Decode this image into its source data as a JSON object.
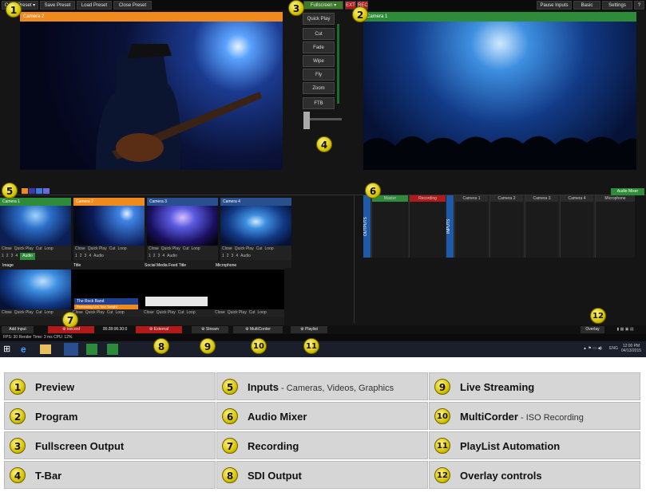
{
  "toolbar": {
    "open_preset": "Open Preset",
    "save_preset": "Save Preset",
    "load_preset": "Load Preset",
    "close_preset": "Close Preset",
    "fullscreen": "Fullscreen",
    "ext": "EXT",
    "rec": "REC",
    "pause_inputs": "Pause Inputs",
    "basic": "Basic",
    "settings": "Settings",
    "help": "?"
  },
  "preview": {
    "label": "Camera 2"
  },
  "program": {
    "label": "Camera 1"
  },
  "transitions": [
    "Quick Play",
    "Cut",
    "Fade",
    "Wipe",
    "Fly",
    "Zoom",
    "FTB"
  ],
  "audio_mixer_button": "Audio Mixer",
  "inputs": [
    {
      "label": "Camera 1",
      "color": "#2e8b3a"
    },
    {
      "label": "Camera 2",
      "color": "#f08a1c"
    },
    {
      "label": "Camera 3",
      "color": "#2a4f8f"
    },
    {
      "label": "Camera 4",
      "color": "#2a4f8f"
    },
    {
      "label": "Image",
      "color": "#1d1d1d"
    },
    {
      "label": "Title",
      "color": "#1d1d1d",
      "title_text": "The Rock Band",
      "title_sub": "Performing Live Tour Tonight"
    },
    {
      "label": "Social Media Feed Title",
      "color": "#1d1d1d"
    },
    {
      "label": "Microphone",
      "color": "#1d1d1d"
    }
  ],
  "input_controls": [
    "Close",
    "Quick Play",
    "Cut",
    "Loop"
  ],
  "input_numbers": [
    "1",
    "2",
    "3",
    "4",
    "Audio"
  ],
  "mixer": {
    "outputs_label": "OUTPUTS",
    "inputs_label": "INPUTS",
    "master": "Master",
    "recording": "Recording",
    "channels": [
      "Camera 1",
      "Camera 2",
      "Camera 3",
      "Camera 4",
      "Microphone"
    ],
    "buttons": [
      "M",
      "A",
      "B"
    ]
  },
  "bottom": {
    "add_input": "Add Input",
    "record": "Record",
    "record_time": "00:28:06:30:0",
    "external": "External",
    "stream": "Stream",
    "multicorder": "MultiCorder",
    "playlist": "Playlist",
    "overlay": "Overlay"
  },
  "status": {
    "text": "FPS: 30  Render Time: 3 ms  CPU: 12%"
  },
  "taskbar": {
    "lang": "ENG",
    "time": "12:00 PM",
    "date": "04/13/2015"
  },
  "legend": [
    {
      "n": "1",
      "title": "Preview",
      "sub": ""
    },
    {
      "n": "5",
      "title": "Inputs",
      "sub": " - Cameras, Videos, Graphics"
    },
    {
      "n": "9",
      "title": "Live Streaming",
      "sub": ""
    },
    {
      "n": "2",
      "title": "Program",
      "sub": ""
    },
    {
      "n": "6",
      "title": "Audio Mixer",
      "sub": ""
    },
    {
      "n": "10",
      "title": "MultiCorder",
      "sub": " - ISO Recording"
    },
    {
      "n": "3",
      "title": "Fullscreen Output",
      "sub": ""
    },
    {
      "n": "7",
      "title": "Recording",
      "sub": ""
    },
    {
      "n": "11",
      "title": "PlayList Automation",
      "sub": ""
    },
    {
      "n": "4",
      "title": "T-Bar",
      "sub": ""
    },
    {
      "n": "8",
      "title": "SDI Output",
      "sub": ""
    },
    {
      "n": "12",
      "title": "Overlay controls",
      "sub": ""
    }
  ],
  "badges": [
    "1",
    "2",
    "3",
    "4",
    "5",
    "6",
    "7",
    "8",
    "9",
    "10",
    "11",
    "12"
  ]
}
